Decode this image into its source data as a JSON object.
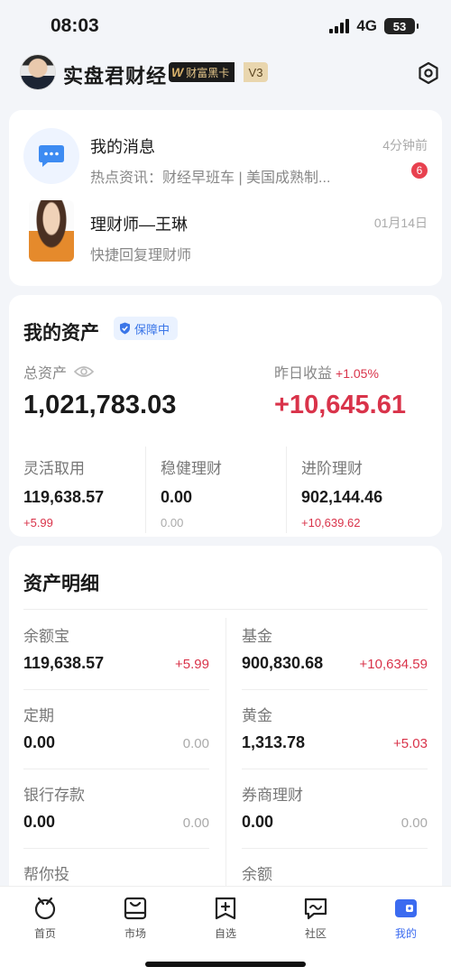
{
  "status": {
    "time": "08:03",
    "network": "4G",
    "battery": "53"
  },
  "header": {
    "username": "实盘君财经",
    "vip_label": "财富黑卡",
    "vip_logo": "W",
    "vip_level": "V3"
  },
  "messages": {
    "title": "我的消息",
    "time": "4分钟前",
    "preview": "热点资讯：财经早班车 | 美国成熟制...",
    "unread": "6"
  },
  "advisor": {
    "name": "理财师—王琳",
    "date": "01月14日",
    "subtitle": "快捷回复理财师"
  },
  "assets": {
    "title": "我的资产",
    "badge": "保障中",
    "total_label": "总资产",
    "total_value": "1,021,783.03",
    "yesterday_label": "昨日收益",
    "yesterday_pct": "+1.05%",
    "yesterday_value": "+10,645.61",
    "columns": [
      {
        "label": "灵活取用",
        "value": "119,638.57",
        "delta": "+5.99"
      },
      {
        "label": "稳健理财",
        "value": "0.00",
        "delta": "0.00"
      },
      {
        "label": "进阶理财",
        "value": "902,144.46",
        "delta": "+10,639.62"
      }
    ]
  },
  "detail": {
    "title": "资产明细",
    "left": [
      {
        "label": "余额宝",
        "value": "119,638.57",
        "delta": "+5.99"
      },
      {
        "label": "定期",
        "value": "0.00",
        "delta": "0.00"
      },
      {
        "label": "银行存款",
        "value": "0.00",
        "delta": "0.00"
      },
      {
        "label": "帮你投",
        "value": "",
        "delta": ""
      }
    ],
    "right": [
      {
        "label": "基金",
        "value": "900,830.68",
        "delta": "+10,634.59"
      },
      {
        "label": "黄金",
        "value": "1,313.78",
        "delta": "+5.03"
      },
      {
        "label": "券商理财",
        "value": "0.00",
        "delta": "0.00"
      },
      {
        "label": "余额",
        "value": "",
        "delta": ""
      }
    ]
  },
  "tabs": [
    {
      "label": "首页",
      "icon": "home-icon"
    },
    {
      "label": "市场",
      "icon": "market-icon"
    },
    {
      "label": "自选",
      "icon": "watchlist-icon"
    },
    {
      "label": "社区",
      "icon": "community-icon"
    },
    {
      "label": "我的",
      "icon": "wallet-icon",
      "active": true
    }
  ],
  "colors": {
    "positive": "#d9334a",
    "accent": "#3b6bf0",
    "muted": "#aaaaaa"
  }
}
